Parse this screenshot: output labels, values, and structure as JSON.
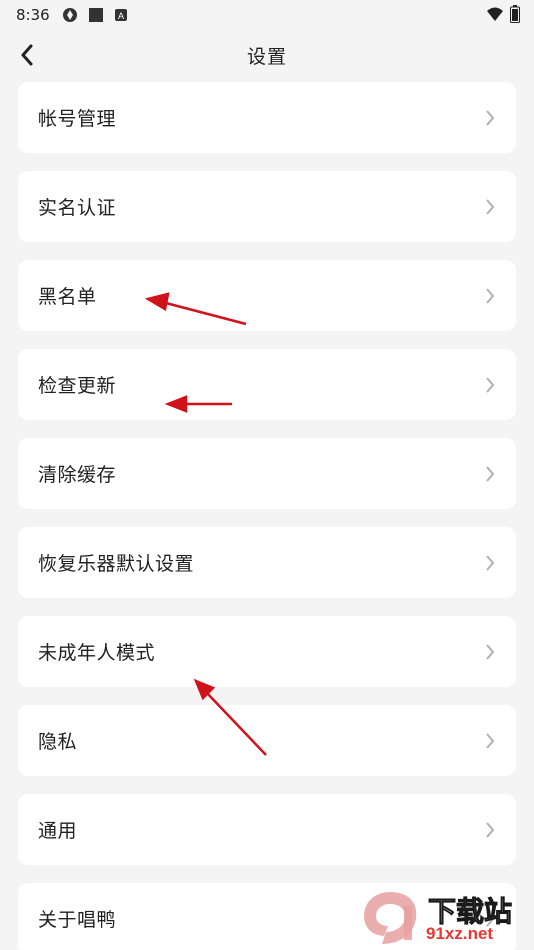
{
  "status_bar": {
    "time": "8:36",
    "left_icons": [
      "aperture-icon",
      "square-icon",
      "a-badge-icon"
    ],
    "right_icons": [
      "wifi-icon",
      "battery-icon"
    ]
  },
  "header": {
    "title": "设置",
    "back_icon": "chevron-left-icon"
  },
  "menu": {
    "items": [
      {
        "label": "帐号管理"
      },
      {
        "label": "实名认证"
      },
      {
        "label": "黑名单"
      },
      {
        "label": "检查更新"
      },
      {
        "label": "清除缓存"
      },
      {
        "label": "恢复乐器默认设置"
      },
      {
        "label": "未成年人模式"
      },
      {
        "label": "隐私"
      },
      {
        "label": "通用"
      },
      {
        "label": "关于唱鸭"
      }
    ]
  },
  "watermark": {
    "text": "下载站",
    "sub": "91xz.net"
  },
  "colors": {
    "background": "#f4f4f4",
    "card": "#ffffff",
    "annotation_arrow": "#d0121b",
    "chevron": "#b0b0b0"
  }
}
